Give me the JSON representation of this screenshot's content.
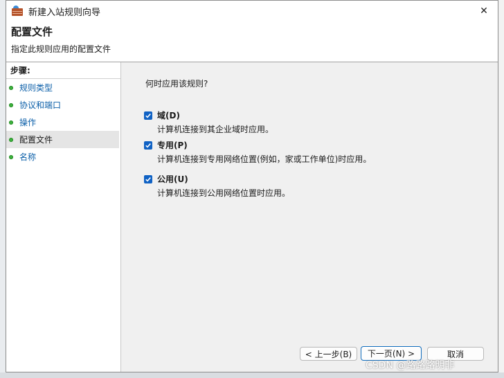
{
  "window": {
    "title": "新建入站规则向导",
    "close_glyph": "✕"
  },
  "header": {
    "title": "配置文件",
    "subtitle": "指定此规则应用的配置文件"
  },
  "steps": {
    "header": "步骤:",
    "items": [
      {
        "label": "规则类型",
        "current": false
      },
      {
        "label": "协议和端口",
        "current": false
      },
      {
        "label": "操作",
        "current": false
      },
      {
        "label": "配置文件",
        "current": true
      },
      {
        "label": "名称",
        "current": false
      }
    ]
  },
  "main": {
    "question": "何时应用该规则?",
    "options": [
      {
        "label": "域(D)",
        "desc": "计算机连接到其企业域时应用。",
        "checked": true
      },
      {
        "label": "专用(P)",
        "desc": "计算机连接到专用网络位置(例如，家或工作单位)时应用。",
        "checked": true
      },
      {
        "label": "公用(U)",
        "desc": "计算机连接到公用网络位置时应用。",
        "checked": true
      }
    ]
  },
  "buttons": {
    "back": "< 上一步(B)",
    "next": "下一页(N) >",
    "cancel": "取消"
  },
  "watermark": "CSDN @路路路明非",
  "colors": {
    "accent": "#1062c4",
    "link": "#0a5ea8",
    "step_dot": "#3db13d"
  }
}
